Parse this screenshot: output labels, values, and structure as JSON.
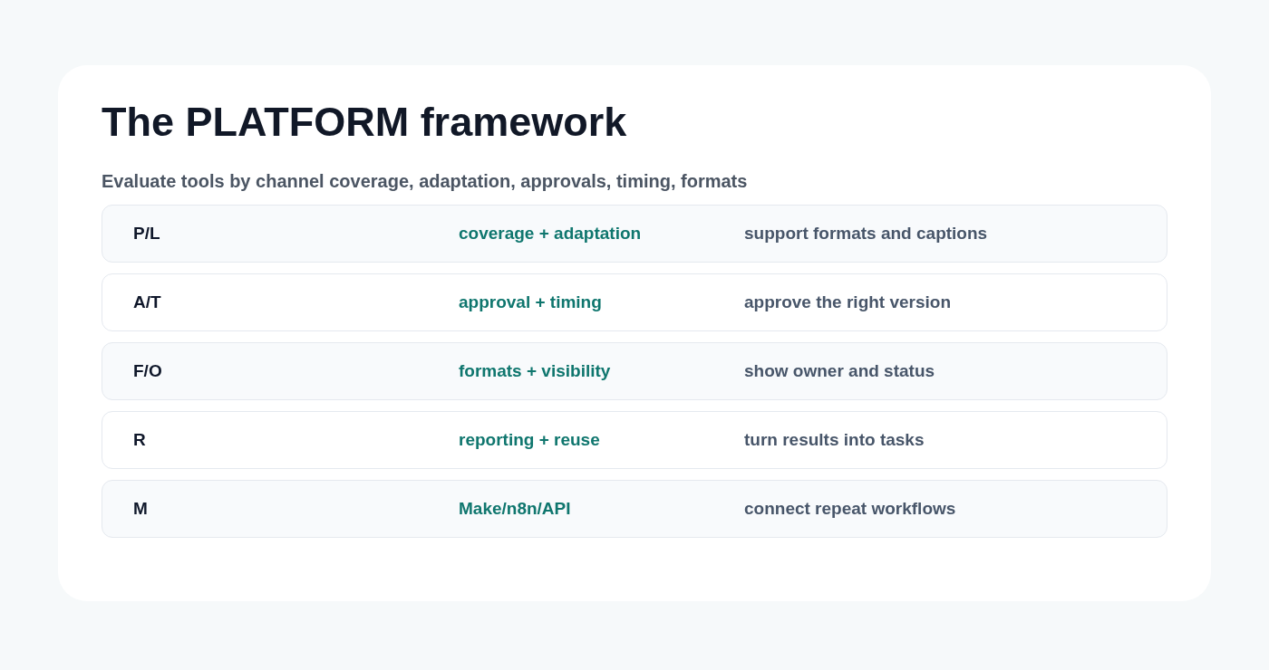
{
  "title": "The PLATFORM framework",
  "subtitle": "Evaluate tools by channel coverage, adaptation, approvals, timing, formats",
  "rows": [
    {
      "letters": "P/L",
      "focus": "coverage + adaptation",
      "action": "support formats and captions"
    },
    {
      "letters": "A/T",
      "focus": "approval + timing",
      "action": "approve the right version"
    },
    {
      "letters": "F/O",
      "focus": "formats + visibility",
      "action": "show owner and status"
    },
    {
      "letters": "R",
      "focus": "reporting + reuse",
      "action": "turn results into tasks"
    },
    {
      "letters": "M",
      "focus": "Make/n8n/API",
      "action": "connect repeat workflows"
    }
  ]
}
